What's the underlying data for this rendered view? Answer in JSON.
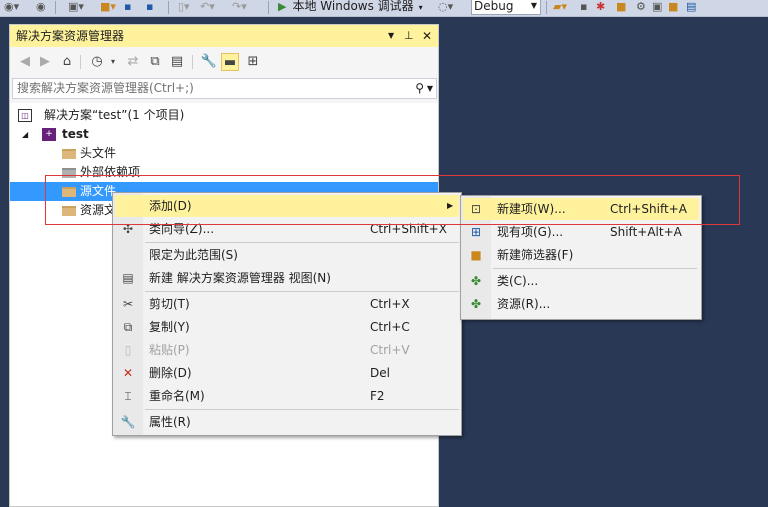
{
  "toolbar": {
    "run_label": "本地 Windows 调试器",
    "config_value": "Debug"
  },
  "panel": {
    "title": "解决方案资源管理器",
    "search_placeholder": "搜索解决方案资源管理器(Ctrl+;)"
  },
  "tree": {
    "solution": "解决方案“test”(1 个项目)",
    "project": "test",
    "items": [
      "头文件",
      "外部依赖项",
      "源文件",
      "资源文"
    ]
  },
  "context_menu": [
    {
      "label": "添加(D)",
      "shortcut": "",
      "icon": "add-icon"
    },
    {
      "label": "类向导(Z)...",
      "shortcut": "Ctrl+Shift+X",
      "icon": "class-wizard-icon"
    },
    {
      "label": "限定为此范围(S)",
      "shortcut": "",
      "icon": ""
    },
    {
      "label": "新建 解决方案资源管理器 视图(N)",
      "shortcut": "",
      "icon": "new-view-icon"
    },
    {
      "label": "剪切(T)",
      "shortcut": "Ctrl+X",
      "icon": "scissors-icon"
    },
    {
      "label": "复制(Y)",
      "shortcut": "Ctrl+C",
      "icon": "copy-icon"
    },
    {
      "label": "粘贴(P)",
      "shortcut": "Ctrl+V",
      "icon": "paste-icon"
    },
    {
      "label": "删除(D)",
      "shortcut": "Del",
      "icon": "delete-icon"
    },
    {
      "label": "重命名(M)",
      "shortcut": "F2",
      "icon": "rename-icon"
    },
    {
      "label": "属性(R)",
      "shortcut": "",
      "icon": "wrench-icon"
    }
  ],
  "submenu": [
    {
      "label": "新建项(W)...",
      "shortcut": "Ctrl+Shift+A",
      "icon": "new-item-icon"
    },
    {
      "label": "现有项(G)...",
      "shortcut": "Shift+Alt+A",
      "icon": "existing-item-icon"
    },
    {
      "label": "新建筛选器(F)",
      "shortcut": "",
      "icon": "new-filter-icon"
    },
    {
      "label": "类(C)...",
      "shortcut": "",
      "icon": "class-icon"
    },
    {
      "label": "资源(R)...",
      "shortcut": "",
      "icon": "resource-icon"
    }
  ],
  "colors": {
    "highlight": "#fff29d",
    "selection": "#3399ff",
    "annotation": "#e0373a",
    "background": "#293955"
  }
}
